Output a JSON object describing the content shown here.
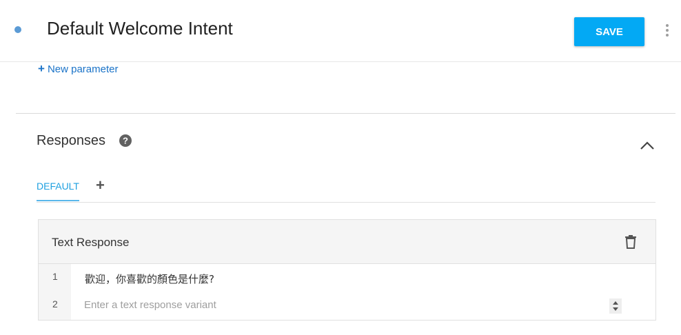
{
  "header": {
    "title": "Default Welcome Intent",
    "save_label": "SAVE"
  },
  "parameters": {
    "new_parameter_label": "New parameter"
  },
  "responses": {
    "title": "Responses",
    "tabs": [
      {
        "label": "DEFAULT",
        "active": true
      }
    ],
    "card": {
      "title": "Text Response",
      "lines": [
        {
          "number": "1",
          "text": "歡迎，你喜歡的顏色是什麼?"
        },
        {
          "number": "2",
          "text": ""
        }
      ],
      "input_placeholder": "Enter a text response variant"
    }
  },
  "colors": {
    "accent": "#03a9f4",
    "link": "#1a73c8",
    "tab_active": "#1ea0e0",
    "status_dot": "#5b9bd5"
  },
  "icons": {
    "status": "status-dot-icon",
    "more": "more-vert-icon",
    "help": "help-circle-icon",
    "collapse": "chevron-up-icon",
    "add_tab": "plus-icon",
    "delete": "trash-icon",
    "spinner": "spinner-arrows-icon"
  }
}
